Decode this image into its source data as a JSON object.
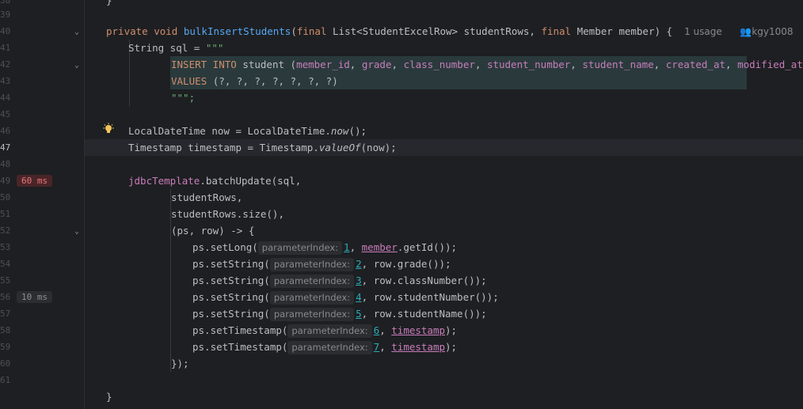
{
  "line_numbers": [
    "38",
    "39",
    "40",
    "41",
    "42",
    "43",
    "44",
    "45",
    "46",
    "47",
    "48",
    "49",
    "50",
    "51",
    "52",
    "53",
    "54",
    "55",
    "56",
    "57",
    "58",
    "59",
    "60",
    "61"
  ],
  "badges": {
    "line48": "60 ms",
    "line55": "10 ms"
  },
  "signature": {
    "private": "private",
    "void": "void",
    "method": "bulkInsertStudents",
    "final1": "final",
    "type1": "List<StudentExcelRow>",
    "param1": "studentRows,",
    "final2": "final",
    "type2": "Member",
    "param2": "member) {",
    "usage": "1 usage",
    "author": "kgy1008"
  },
  "sql": {
    "decl": "String sql = ",
    "open_quotes": "\"\"\"",
    "insert_kw": "INSERT INTO",
    "table": "student (",
    "cols": [
      "member_id",
      "grade",
      "class_number",
      "student_number",
      "student_name",
      "created_at",
      "modified_at"
    ],
    "close_paren": ")",
    "values_kw": "VALUES",
    "values_rest": "(?, ?, ?, ?, ?, ?, ?)",
    "close_quotes": "\"\"\";"
  },
  "now_line": {
    "left": "LocalDateTime now = LocalDateTime.",
    "call": "now",
    "rest": "();"
  },
  "ts_line": {
    "left": "Timestamp timestamp = Timestamp.",
    "call": "valueOf",
    "rest": "(now);"
  },
  "batch": {
    "obj": "jdbcTemplate",
    "call": ".batchUpdate(sql,",
    "arg2": "studentRows,",
    "arg3": "studentRows.size(),",
    "lambda": "(ps, row) -> {"
  },
  "hint_label": "parameterIndex:",
  "setters": [
    {
      "method": "ps.setLong(",
      "idx": "1",
      "arg_pre": "",
      "arg_field": "member",
      "arg_post": ".getId());"
    },
    {
      "method": "ps.setString(",
      "idx": "2",
      "arg_pre": "row.grade());",
      "arg_field": "",
      "arg_post": ""
    },
    {
      "method": "ps.setString(",
      "idx": "3",
      "arg_pre": "row.classNumber());",
      "arg_field": "",
      "arg_post": ""
    },
    {
      "method": "ps.setString(",
      "idx": "4",
      "arg_pre": "row.studentNumber());",
      "arg_field": "",
      "arg_post": ""
    },
    {
      "method": "ps.setString(",
      "idx": "5",
      "arg_pre": "row.studentName());",
      "arg_field": "",
      "arg_post": ""
    },
    {
      "method": "ps.setTimestamp(",
      "idx": "6",
      "arg_pre": "",
      "arg_field": "timestamp",
      "arg_post": ");"
    },
    {
      "method": "ps.setTimestamp(",
      "idx": "7",
      "arg_pre": "",
      "arg_field": "timestamp",
      "arg_post": ");"
    }
  ],
  "close_lambda": "});",
  "close_method": "}",
  "top_brace": "}"
}
